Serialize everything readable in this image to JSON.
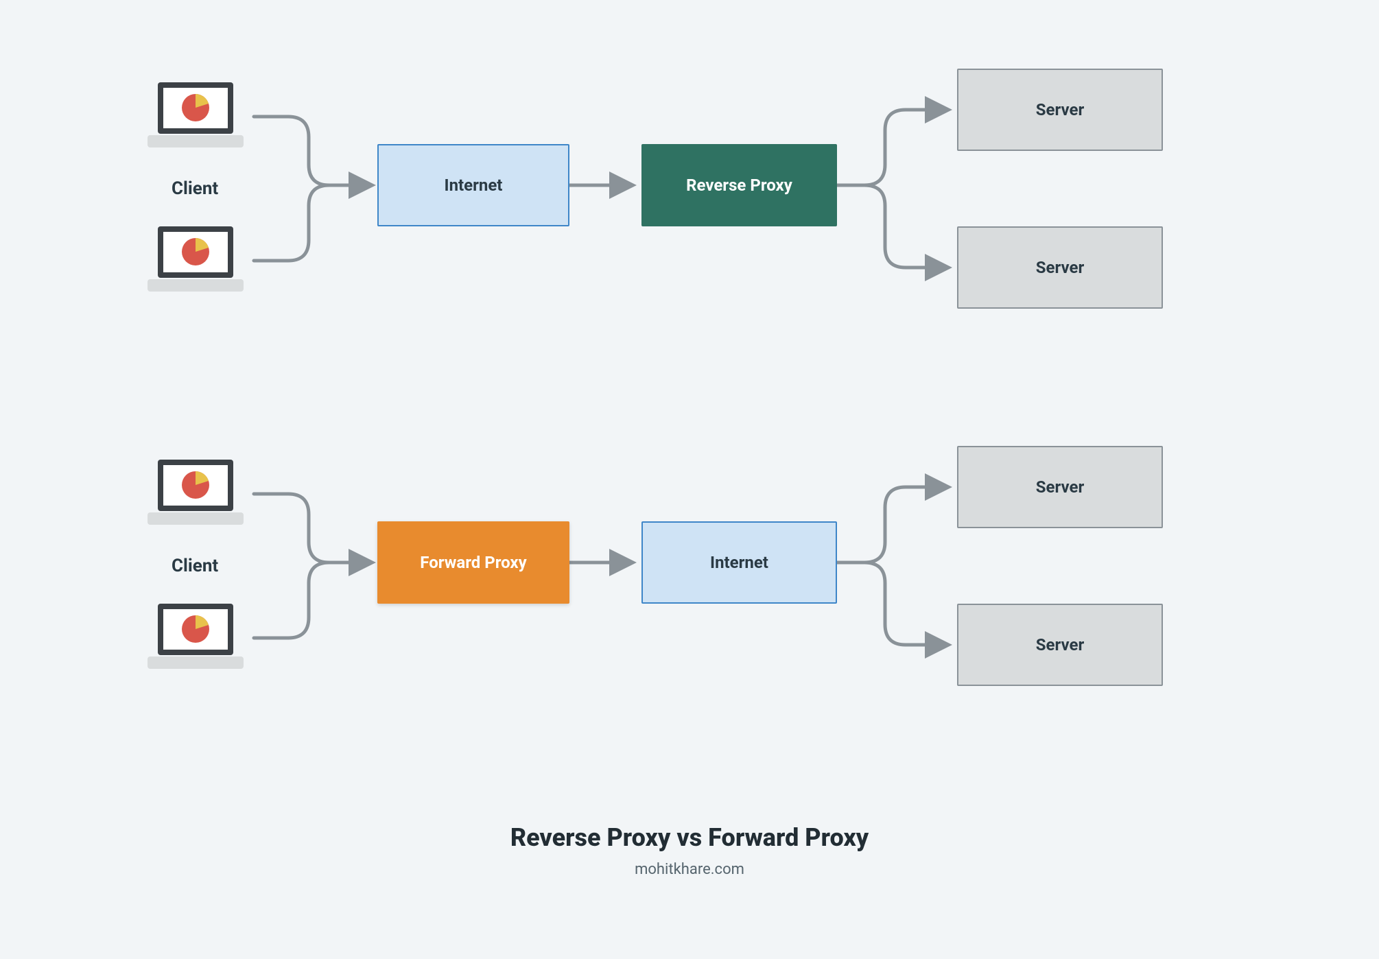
{
  "title": "Reverse Proxy vs Forward Proxy",
  "subtitle": "mohitkhare.com",
  "labels": {
    "client": "Client",
    "internet": "Internet",
    "reverse_proxy": "Reverse Proxy",
    "forward_proxy": "Forward Proxy",
    "server": "Server"
  },
  "colors": {
    "internet_bg": "#cfe3f5",
    "internet_border": "#3e86c8",
    "reverse_bg": "#2f7262",
    "forward_bg": "#e88b2e",
    "server_bg": "#d9dcdd",
    "server_border": "#8a9298",
    "arrow": "#8a9298",
    "laptop_frame": "#3c4146",
    "laptop_base": "#d9dcdd",
    "pie_main": "#d9564a",
    "pie_slice": "#e8c24b"
  },
  "diagrams": [
    {
      "name": "reverse-proxy-flow",
      "left_label": "Client",
      "nodes": [
        "Client",
        "Client",
        "Internet",
        "Reverse Proxy",
        "Server",
        "Server"
      ],
      "flow": "Clients → Internet → Reverse Proxy → Servers"
    },
    {
      "name": "forward-proxy-flow",
      "left_label": "Client",
      "nodes": [
        "Client",
        "Client",
        "Forward Proxy",
        "Internet",
        "Server",
        "Server"
      ],
      "flow": "Clients → Forward Proxy → Internet → Servers"
    }
  ]
}
